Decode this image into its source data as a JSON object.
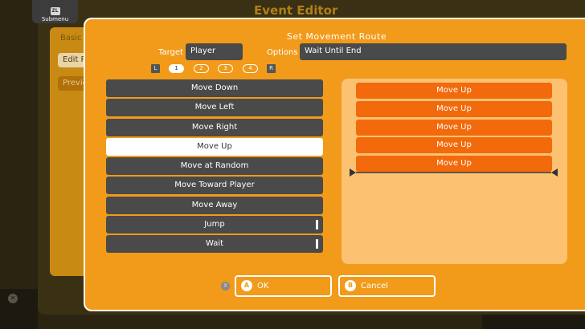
{
  "background": {
    "title": "Event Editor",
    "section_label": "Basic S",
    "edit_button": "Edit R",
    "preview_button": "Previe"
  },
  "submenu": {
    "key": "ZL",
    "label": "Submenu"
  },
  "dialog": {
    "title": "Set Movement Route",
    "target_label": "Target",
    "target_value": "Player",
    "options_label": "Options",
    "options_value": "Wait Until End",
    "page_left": "L",
    "page_right": "R",
    "pages": [
      "1",
      "2",
      "3",
      "4"
    ],
    "active_page": "1"
  },
  "commands": [
    {
      "label": "Move Down"
    },
    {
      "label": "Move Left"
    },
    {
      "label": "Move Right"
    },
    {
      "label": "Move Up"
    },
    {
      "label": "Move at Random"
    },
    {
      "label": "Move Toward Player"
    },
    {
      "label": "Move Away"
    },
    {
      "label": "Jump"
    },
    {
      "label": "Wait"
    }
  ],
  "selected_command": "Move Up",
  "route": [
    "Move Up",
    "Move Up",
    "Move Up",
    "Move Up",
    "Move Up"
  ],
  "buttons": {
    "close_key": "X",
    "ok_key": "A",
    "ok_label": "OK",
    "cancel_key": "B",
    "cancel_label": "Cancel"
  },
  "colors": {
    "dialog_bg": "#f29a1a",
    "route_item": "#f26a0c",
    "command_bg": "#4a4a4a",
    "route_panel": "#fcc272"
  }
}
